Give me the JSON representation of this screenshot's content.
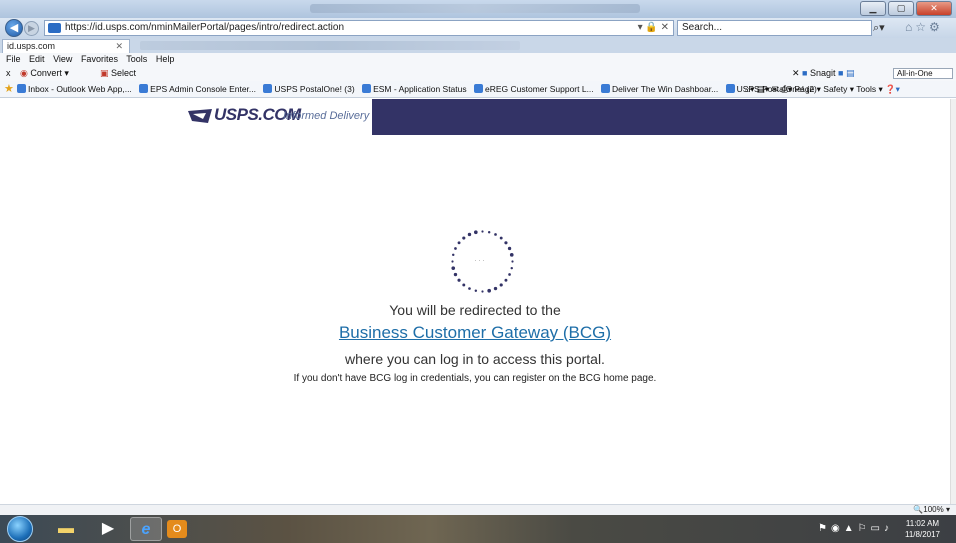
{
  "browser": {
    "url": "https://id.usps.com/nminMailerPortal/pages/intro/redirect.action",
    "url_controls": "▾ 🔒 ✕",
    "search_placeholder": "Search...",
    "tab_title": "id.usps.com",
    "menu": [
      "File",
      "Edit",
      "View",
      "Favorites",
      "Tools",
      "Help"
    ],
    "command_bar": {
      "close": "x",
      "convert": "Convert ▾",
      "select": "Select",
      "snagit": "Snagit",
      "allinone": "All-in-One"
    },
    "favorites": [
      "Inbox - Outlook Web App,...",
      "EPS Admin Console Enter...",
      "USPS PostalOne! (3)",
      "ESM - Application Status",
      "eREG Customer Support L...",
      "Deliver The Win Dashboar...",
      "USPS PostalOne! (2)"
    ],
    "fav_tools": [
      "Page ▾",
      "Safety ▾",
      "Tools ▾"
    ],
    "zoom": "100%"
  },
  "page": {
    "logo_text": "USPS.COM",
    "logo_sub": "Informed Delivery",
    "spinner_center": "···",
    "redirect_line1": "You will be redirected to the",
    "redirect_link": "Business Customer Gateway (BCG)",
    "redirect_line2": "where you can log in to access this portal.",
    "redirect_line3": "If you don't have BCG log in credentials, you can register on the BCG home page."
  },
  "taskbar": {
    "time": "11:02 AM",
    "date": "11/8/2017"
  }
}
